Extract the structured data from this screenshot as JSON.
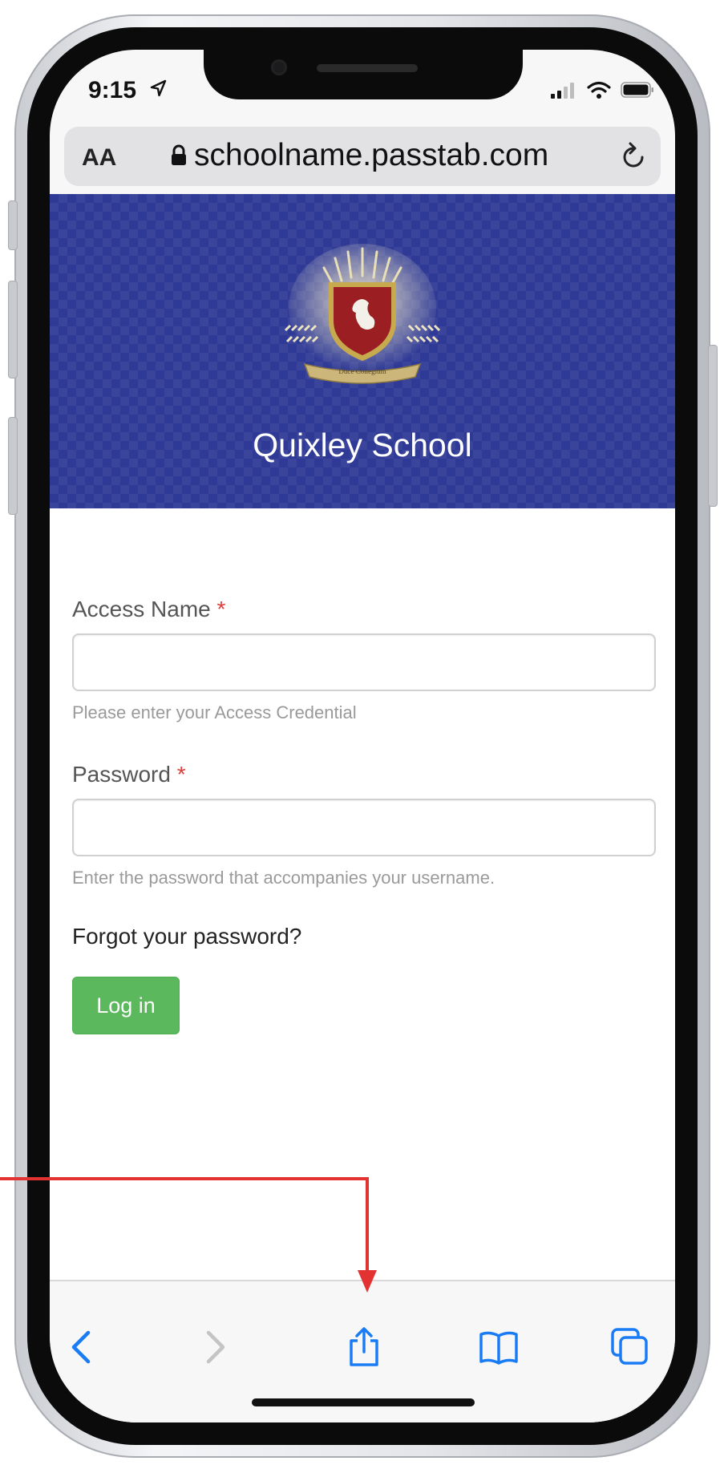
{
  "status_bar": {
    "time": "9:15"
  },
  "browser": {
    "text_size_label": "AA",
    "url": "schoolname.passtab.com"
  },
  "hero": {
    "school_name": "Quixley School",
    "crest_motto": "Duce Collegium"
  },
  "login_form": {
    "access_name_label": "Access Name",
    "access_name_required": "*",
    "access_name_value": "",
    "access_name_help": "Please enter your Access Credential",
    "password_label": "Password",
    "password_required": "*",
    "password_value": "",
    "password_help": "Enter the password that accompanies your username.",
    "forgot_link": "Forgot your password?",
    "login_button": "Log in"
  },
  "toolbar": {
    "items": [
      "back-icon",
      "forward-icon",
      "share-icon",
      "bookmarks-icon",
      "tabs-icon"
    ]
  },
  "colors": {
    "hero_bg": "#2f3a96",
    "button_green": "#5cb85c",
    "required_red": "#e03a3a",
    "annotation_red": "#e23232",
    "ios_blue": "#1a7cf5"
  }
}
